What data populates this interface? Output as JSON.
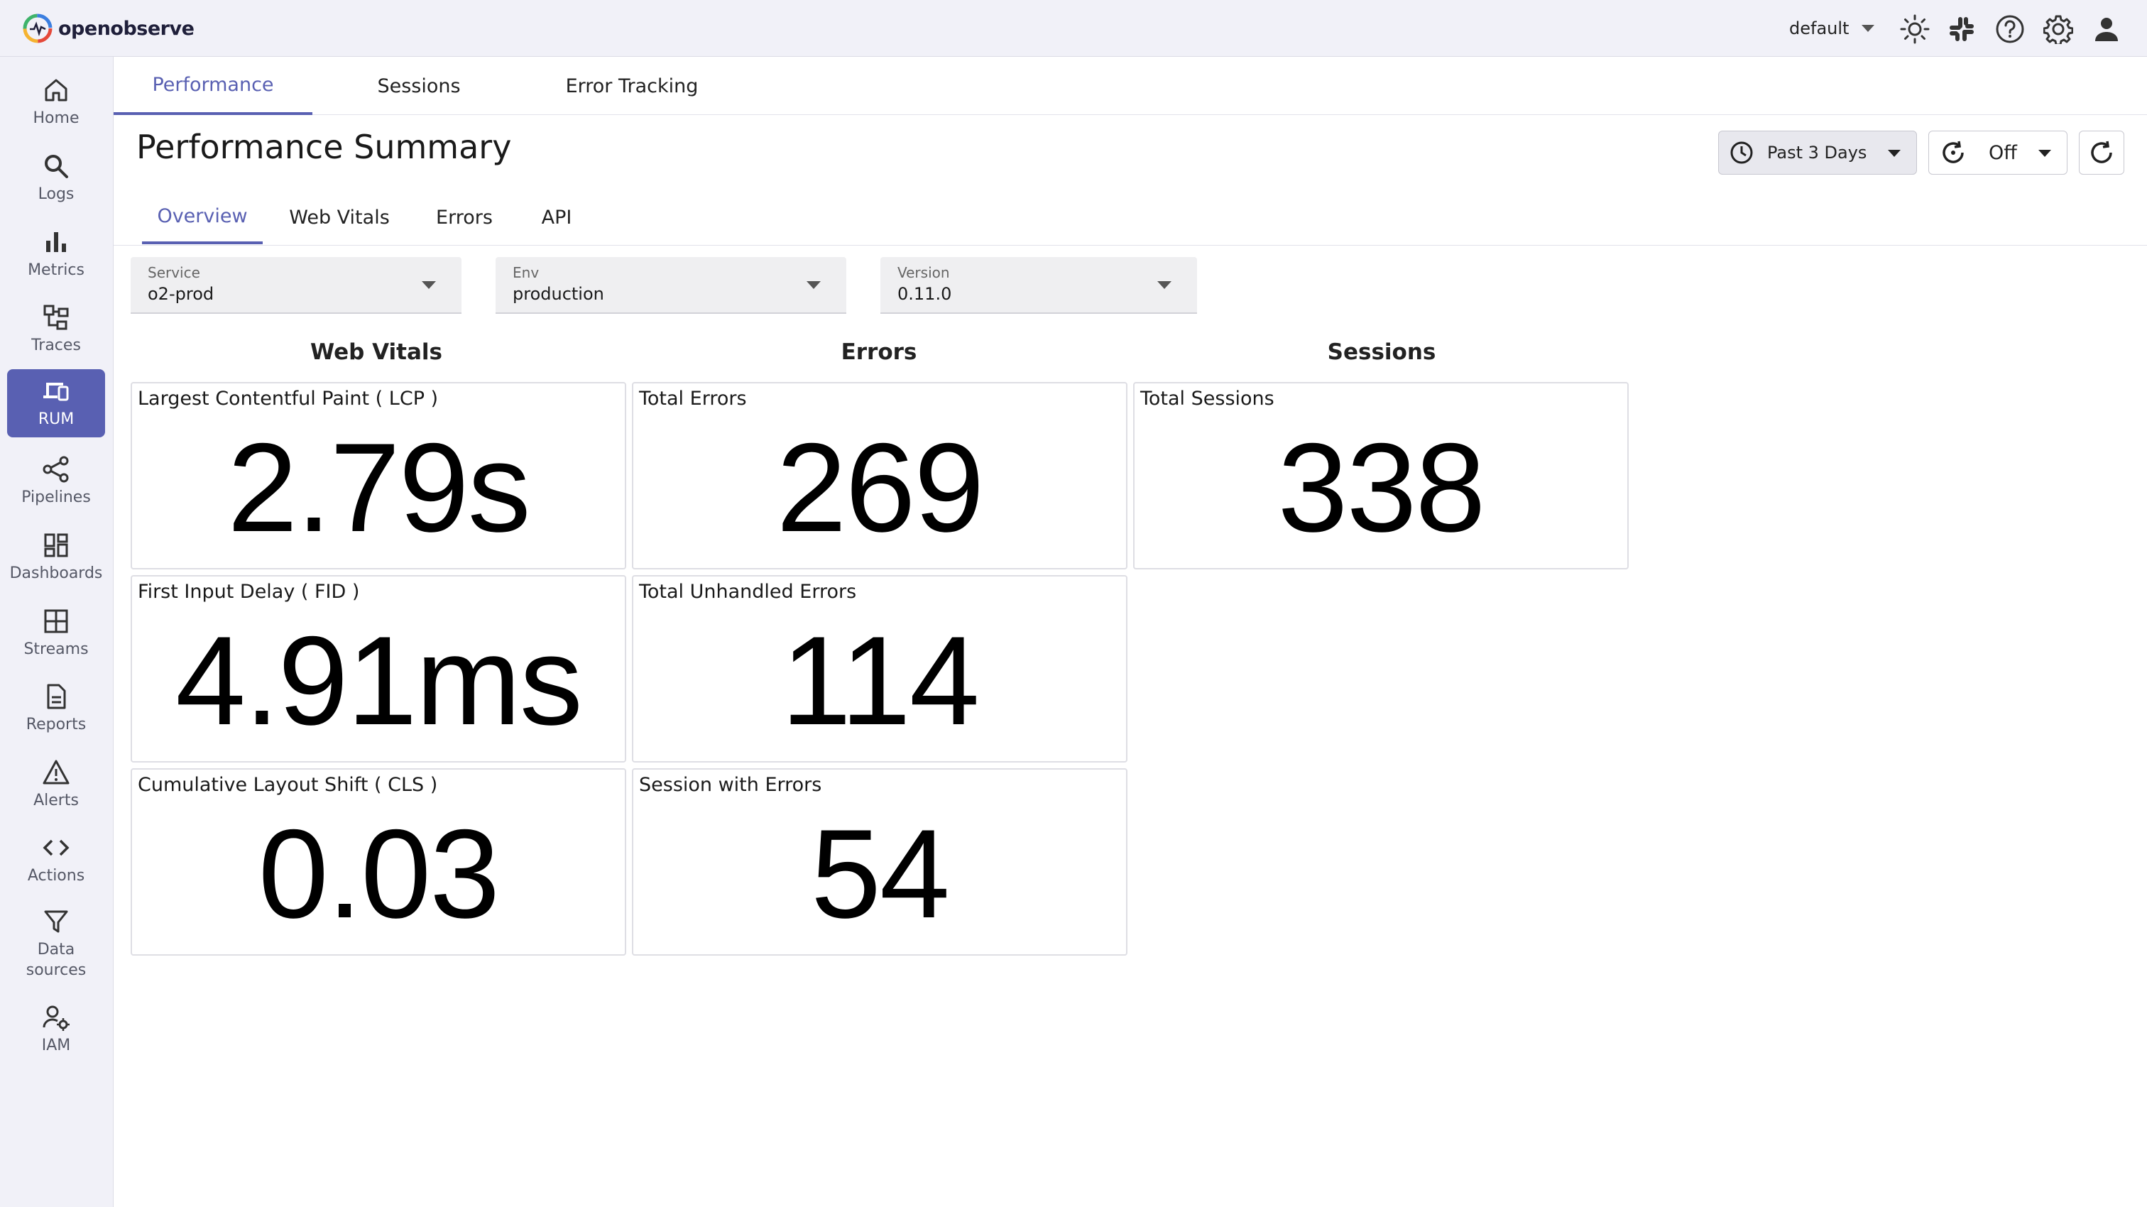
{
  "app": {
    "name": "openobserve"
  },
  "header": {
    "org": "default"
  },
  "sidebar": {
    "items": [
      {
        "label": "Home"
      },
      {
        "label": "Logs"
      },
      {
        "label": "Metrics"
      },
      {
        "label": "Traces"
      },
      {
        "label": "RUM"
      },
      {
        "label": "Pipelines"
      },
      {
        "label": "Dashboards"
      },
      {
        "label": "Streams"
      },
      {
        "label": "Reports"
      },
      {
        "label": "Alerts"
      },
      {
        "label": "Actions"
      },
      {
        "label": "Data\nsources"
      },
      {
        "label": "IAM"
      }
    ],
    "active": "RUM"
  },
  "main_tabs": [
    {
      "label": "Performance"
    },
    {
      "label": "Sessions"
    },
    {
      "label": "Error Tracking"
    }
  ],
  "page": {
    "title": "Performance Summary",
    "date_range": "Past 3 Days",
    "refresh_interval": "Off"
  },
  "sub_tabs": [
    {
      "label": "Overview"
    },
    {
      "label": "Web Vitals"
    },
    {
      "label": "Errors"
    },
    {
      "label": "API"
    }
  ],
  "filters": [
    {
      "label": "Service",
      "value": "o2-prod"
    },
    {
      "label": "Env",
      "value": "production"
    },
    {
      "label": "Version",
      "value": "0.11.0"
    }
  ],
  "sections": {
    "web_vitals": "Web Vitals",
    "errors": "Errors",
    "sessions": "Sessions"
  },
  "cards": {
    "lcp": {
      "title": "Largest Contentful Paint ( LCP )",
      "value": "2.79s"
    },
    "fid": {
      "title": "First Input Delay ( FID )",
      "value": "4.91ms"
    },
    "cls": {
      "title": "Cumulative Layout Shift ( CLS )",
      "value": "0.03"
    },
    "total_errors": {
      "title": "Total Errors",
      "value": "269"
    },
    "unhandled_errors": {
      "title": "Total Unhandled Errors",
      "value": "114"
    },
    "session_errors": {
      "title": "Session with Errors",
      "value": "54"
    },
    "total_sessions": {
      "title": "Total Sessions",
      "value": "338"
    }
  },
  "colors": {
    "accent": "#5960b2",
    "sidebar_bg": "#f1f1f8"
  }
}
